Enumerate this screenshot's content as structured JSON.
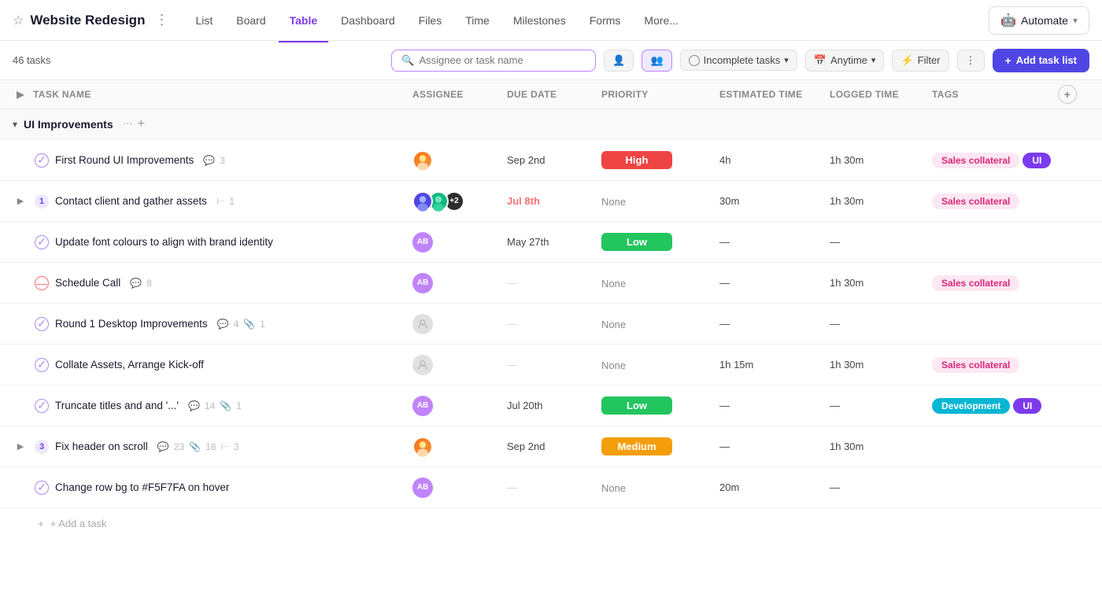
{
  "project": {
    "title": "Website Redesign",
    "task_count": "46 tasks"
  },
  "nav": {
    "tabs": [
      "List",
      "Board",
      "Table",
      "Dashboard",
      "Files",
      "Time",
      "Milestones",
      "Forms",
      "More..."
    ],
    "active_tab": "Table",
    "automate_label": "Automate"
  },
  "toolbar": {
    "search_placeholder": "Assignee or task name",
    "incomplete_tasks_label": "Incomplete tasks",
    "anytime_label": "Anytime",
    "filter_label": "Filter",
    "add_task_list_label": "+ Add task list"
  },
  "columns": {
    "task_name": "Task Name",
    "assignee": "Assignee",
    "due_date": "Due Date",
    "priority": "Priority",
    "estimated_time": "Estimated Time",
    "logged_time": "Logged Time",
    "tags": "Tags"
  },
  "group": {
    "title": "UI Improvements"
  },
  "tasks": [
    {
      "id": 1,
      "indent": 1,
      "status": "done",
      "title": "First Round UI Improvements",
      "comment_count": "3",
      "has_subtasks": false,
      "subtask_badge": null,
      "assignee_type": "avatar_img",
      "assignee_color": "#f97316",
      "assignee_initials": "AV",
      "due_date": "Sep 2nd",
      "due_overdue": false,
      "priority": "High",
      "priority_type": "high",
      "estimated_time": "4h",
      "logged_time": "1h 30m",
      "tags": [
        "Sales collateral",
        "UI"
      ]
    },
    {
      "id": 2,
      "indent": 1,
      "status": "expandable",
      "badge": "1",
      "title": "Contact client and gather assets",
      "subtask_count": "1",
      "has_subtasks": true,
      "assignee_type": "multi",
      "due_date": "Jul 8th",
      "due_overdue": true,
      "priority": "None",
      "priority_type": "none",
      "estimated_time": "30m",
      "logged_time": "1h 30m",
      "tags": [
        "Sales collateral"
      ]
    },
    {
      "id": 3,
      "indent": 1,
      "status": "done",
      "title": "Update font colours to align with brand identity",
      "comment_count": null,
      "has_subtasks": false,
      "assignee_type": "initials",
      "assignee_initials": "AB",
      "assignee_color": "#c084fc",
      "due_date": "May 27th",
      "due_overdue": false,
      "priority": "Low",
      "priority_type": "low",
      "estimated_time": "—",
      "logged_time": "—",
      "tags": []
    },
    {
      "id": 4,
      "indent": 1,
      "status": "cancelled",
      "title": "Schedule Call",
      "comment_count": "8",
      "has_subtasks": false,
      "assignee_type": "initials",
      "assignee_initials": "AB",
      "assignee_color": "#c084fc",
      "due_date": "—",
      "due_overdue": false,
      "priority": "None",
      "priority_type": "none",
      "estimated_time": "—",
      "logged_time": "1h 30m",
      "tags": [
        "Sales collateral"
      ]
    },
    {
      "id": 5,
      "indent": 1,
      "status": "done",
      "title": "Round 1 Desktop Improvements",
      "comment_count": "4",
      "attachment_count": "1",
      "has_subtasks": false,
      "assignee_type": "placeholder",
      "due_date": "—",
      "due_overdue": false,
      "priority": "None",
      "priority_type": "none",
      "estimated_time": "—",
      "logged_time": "—",
      "tags": []
    },
    {
      "id": 6,
      "indent": 1,
      "status": "done",
      "title": "Collate Assets, Arrange Kick-off",
      "comment_count": null,
      "has_subtasks": false,
      "assignee_type": "placeholder",
      "due_date": "—",
      "due_overdue": false,
      "priority": "None",
      "priority_type": "none",
      "estimated_time": "1h 15m",
      "logged_time": "1h 30m",
      "tags": [
        "Sales collateral"
      ]
    },
    {
      "id": 7,
      "indent": 1,
      "status": "done",
      "title": "Truncate titles and and '...'",
      "comment_count": "14",
      "attachment_count": "1",
      "has_subtasks": false,
      "assignee_type": "initials",
      "assignee_initials": "AB",
      "assignee_color": "#c084fc",
      "due_date": "Jul 20th",
      "due_overdue": false,
      "priority": "Low",
      "priority_type": "low",
      "estimated_time": "—",
      "logged_time": "—",
      "tags": [
        "Development",
        "UI"
      ]
    },
    {
      "id": 8,
      "indent": 1,
      "status": "expandable",
      "badge": "3",
      "title": "Fix header on scroll",
      "comment_count": "23",
      "attachment_count": "18",
      "subtask_count": "3",
      "has_subtasks": true,
      "assignee_type": "avatar_img",
      "assignee_color": "#f97316",
      "due_date": "Sep 2nd",
      "due_overdue": false,
      "priority": "Medium",
      "priority_type": "medium",
      "estimated_time": "—",
      "logged_time": "1h 30m",
      "tags": []
    },
    {
      "id": 9,
      "indent": 1,
      "status": "done",
      "title": "Change row bg to #F5F7FA on hover",
      "comment_count": null,
      "has_subtasks": false,
      "assignee_type": "initials",
      "assignee_initials": "AB",
      "assignee_color": "#c084fc",
      "due_date": "—",
      "due_overdue": false,
      "priority": "None",
      "priority_type": "none",
      "estimated_time": "20m",
      "logged_time": "—",
      "tags": []
    }
  ],
  "add_task_label": "+ Add a task"
}
